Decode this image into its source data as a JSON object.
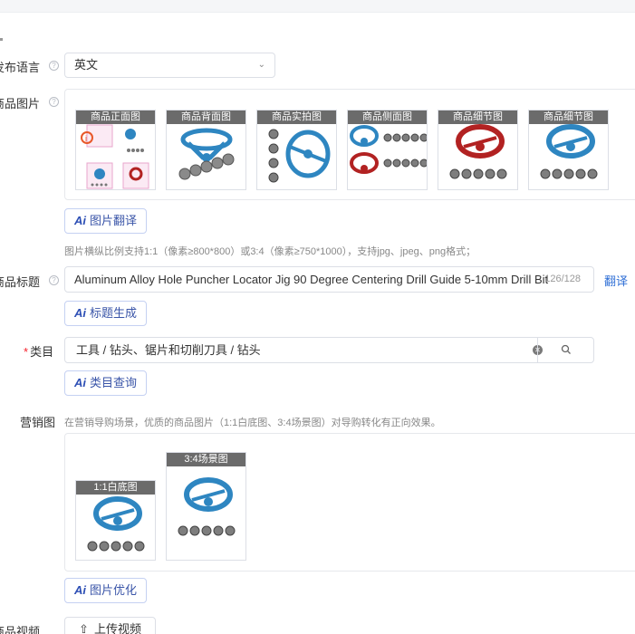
{
  "form": {
    "language": {
      "label": "发布语言",
      "value": "英文"
    },
    "images": {
      "label": "商品图片",
      "thumbs": [
        {
          "tag": "商品正面图"
        },
        {
          "tag": "商品背面图"
        },
        {
          "tag": "商品实拍图"
        },
        {
          "tag": "商品侧面图"
        },
        {
          "tag": "商品细节图"
        },
        {
          "tag": "商品细节图"
        }
      ],
      "translate_button": "图片翻译",
      "hint": "图片横纵比例支持1:1（像素≥800*800）或3:4（像素≥750*1000），支持jpg、jpeg、png格式；"
    },
    "title": {
      "label": "商品标题",
      "value": "Aluminum Alloy Hole Puncher Locator Jig 90 Degree Centering Drill Guide 5-10mm Drill Bit",
      "count": "126/128",
      "translate_link": "翻译",
      "generate_button": "标题生成"
    },
    "category": {
      "required_mark": "*",
      "label": "类目",
      "value": "工具 / 钻头、锯片和切削刀具 / 钻头",
      "query_button": "类目查询"
    },
    "marketing": {
      "label": "营销图",
      "hint": "在营销导购场景，优质的商品图片（1:1白底图、3:4场景图）对导购转化有正向效果。",
      "thumbs": [
        {
          "tag": "1:1白底图"
        },
        {
          "tag": "3:4场景图"
        }
      ],
      "optimize_button": "图片优化"
    },
    "video": {
      "label": "商品视频",
      "upload_button": "上传视频"
    }
  },
  "icons": {
    "help": "help-circle-icon",
    "chevron": "chevron-down-icon",
    "clear": "clear-icon",
    "search": "search-icon",
    "upload": "upload-icon"
  },
  "colors": {
    "accent": "#2f6fd6",
    "ai_button_text": "#3a55a8",
    "required": "#f5222d",
    "product_blue": "#2e86c1",
    "product_red": "#b22222",
    "tag_bg": "#6b6b6b"
  }
}
